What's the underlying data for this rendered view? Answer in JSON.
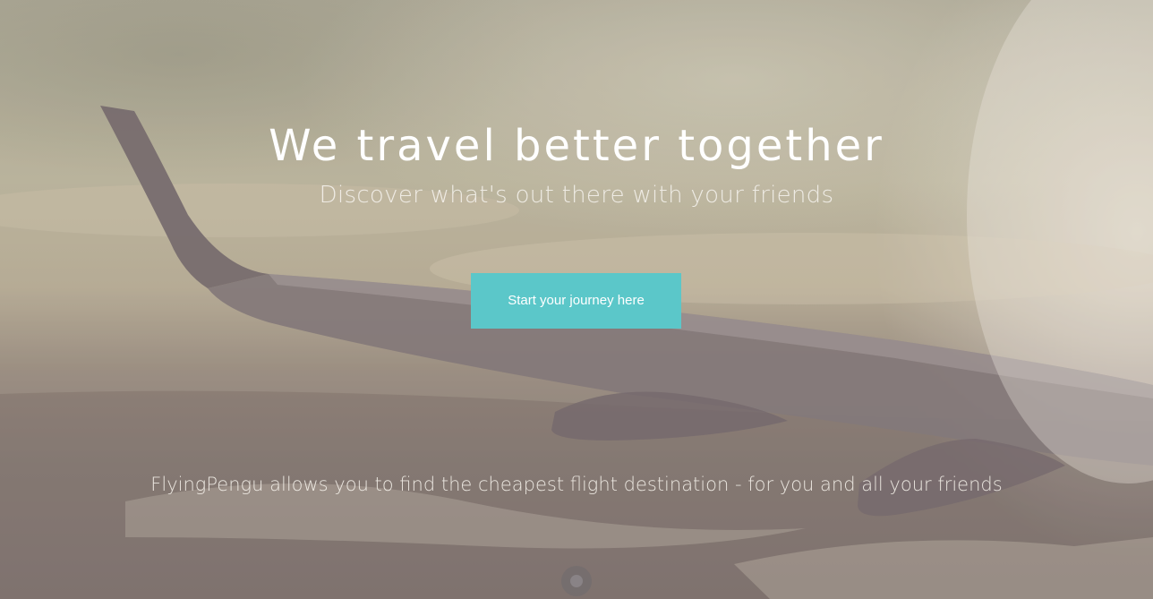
{
  "hero": {
    "headline": "We travel better together",
    "subheadline": "Discover what's out there with your friends",
    "cta_label": "Start your journey here",
    "tagline": "FlyingPengu allows you to find the cheapest flight destination - for you and all your friends"
  },
  "colors": {
    "accent": "#5bc7c9",
    "text": "#ffffff"
  },
  "icons": {
    "scroll": "scroll-down-icon",
    "background": "airplane-wing-photo"
  }
}
